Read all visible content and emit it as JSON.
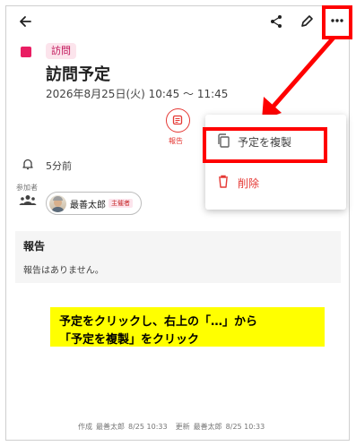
{
  "event": {
    "tag": "訪問",
    "title": "訪問予定",
    "datetime": "2026年8月25日(火) 10:45 ～ 11:45",
    "color": "#e91e63"
  },
  "toolbar": {
    "back_icon": "arrow-left-icon",
    "share_icon": "share-icon",
    "edit_icon": "pencil-icon",
    "more_icon": "more-horizontal-icon"
  },
  "report_button": {
    "label": "報告"
  },
  "reminder": {
    "text": "5分前"
  },
  "participants": {
    "label": "参加者",
    "items": [
      {
        "name": "最善太郎",
        "role": "主催者"
      }
    ]
  },
  "report_section": {
    "title": "報告",
    "empty_text": "報告はありません。"
  },
  "menu": {
    "items": [
      {
        "label": "予定を複製",
        "icon": "copy-icon"
      },
      {
        "label": "削除",
        "icon": "trash-icon"
      }
    ]
  },
  "annotation": {
    "line1": "予定をクリックし、右上の「…」から",
    "line2": "「予定を複製」をクリック",
    "highlight_color": "#ff0000",
    "note_color": "#ffff00"
  },
  "footer": {
    "created_label": "作成",
    "created_by": "最善太郎",
    "created_at": "8/25 10:33",
    "updated_label": "更新",
    "updated_by": "最善太郎",
    "updated_at": "8/25 10:33"
  }
}
